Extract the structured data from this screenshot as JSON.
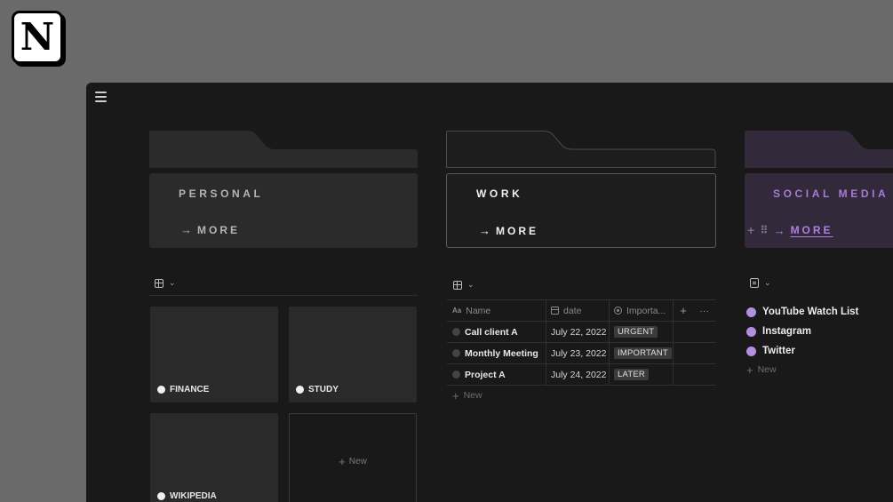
{
  "logo": {
    "letter": "N"
  },
  "folders": {
    "personal": {
      "title": "PERSONAL",
      "more": "MORE",
      "arrow": "→"
    },
    "work": {
      "title": "WORK",
      "more": "MORE",
      "arrow": "→"
    },
    "social": {
      "title": "SOCIAL MEDIA",
      "more": "MORE",
      "arrow": "→",
      "plus": "+",
      "drag": "⠿",
      "accent": "#b07ee6"
    }
  },
  "gallery": {
    "cards": [
      "FINANCE",
      "STUDY",
      "WIKIPEDIA"
    ],
    "new_label": "New",
    "plus": "+"
  },
  "table": {
    "headers": {
      "name": "Name",
      "date": "date",
      "importance": "Importa...",
      "add": "+",
      "more": "···"
    },
    "rows": [
      {
        "name": "Call client A",
        "date": "July 22, 2022",
        "tag": "URGENT"
      },
      {
        "name": "Monthly Meeting",
        "date": "July 23, 2022",
        "tag": "IMPORTANT"
      },
      {
        "name": "Project A",
        "date": "July 24, 2022",
        "tag": "LATER"
      }
    ],
    "new_label": "New",
    "plus": "+"
  },
  "list": {
    "items": [
      "YouTube Watch List",
      "Instagram",
      "Twitter"
    ],
    "new_label": "New",
    "plus": "+"
  },
  "icons": {
    "chevron": "⌄",
    "aa": "Aa"
  }
}
